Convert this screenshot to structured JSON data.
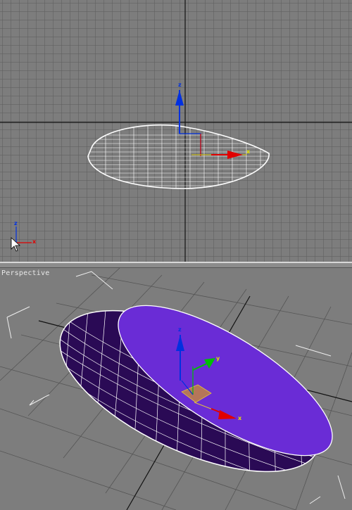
{
  "viewports": {
    "top": {
      "label": "",
      "gizmo": {
        "axis_z": "z",
        "axis_x": "x"
      },
      "world_axis": {
        "axis_z": "z",
        "axis_x": "x"
      }
    },
    "perspective": {
      "label": "Perspective",
      "gizmo": {
        "axis_z": "z",
        "axis_y": "y",
        "axis_x": "x"
      }
    }
  },
  "colors": {
    "background": "#7d7d7d",
    "grid": "#5f5f5f",
    "grid_major": "#111111",
    "wireframe": "#ffffff",
    "object_fill": "#6a2cd6",
    "axis_x": "#e00000",
    "axis_y": "#00c000",
    "axis_z": "#0030e0"
  }
}
